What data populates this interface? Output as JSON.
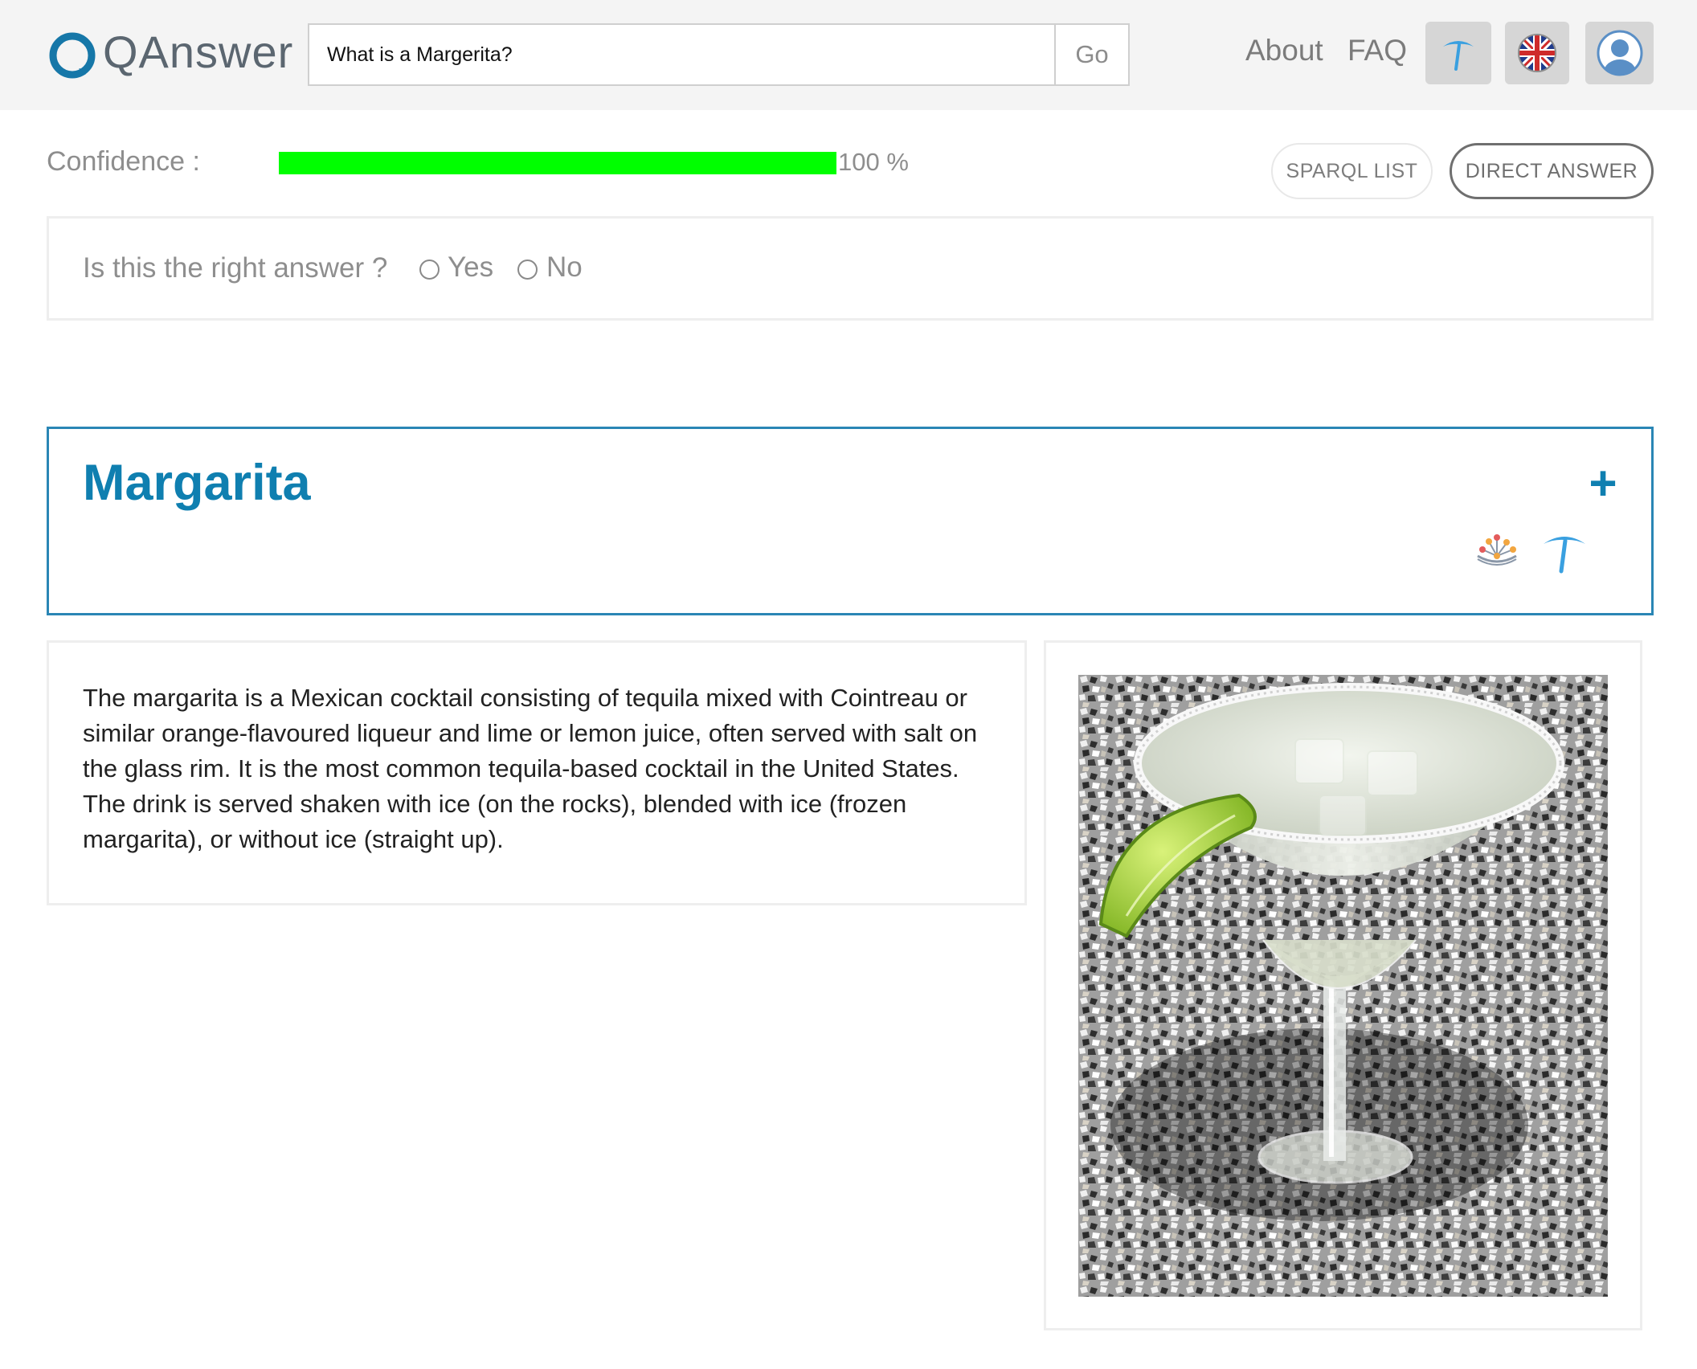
{
  "header": {
    "logo_text": "QAnswer",
    "search_value": "What is a Margerita?",
    "go_label": "Go",
    "nav": {
      "about": "About",
      "faq": "FAQ"
    },
    "icons": [
      "umbrella-icon",
      "uk-flag-icon",
      "user-icon"
    ]
  },
  "confidence": {
    "label": "Confidence :",
    "value_text": "100 %",
    "percent": 100,
    "bar_color": "#00ff00"
  },
  "modes": {
    "sparql_list": "SPARQL LIST",
    "direct_answer": "DIRECT ANSWER"
  },
  "feedback": {
    "question": "Is this the right answer ?",
    "yes": "Yes",
    "no": "No"
  },
  "answer": {
    "title": "Margarita",
    "plus": "+",
    "source_icons": [
      "knowledge-graph-icon",
      "umbrella-icon"
    ],
    "description": "The margarita is a Mexican cocktail consisting of tequila mixed with Cointreau or similar orange-flavoured liqueur and lime or lemon juice, often served with salt on the glass rim. It is the most common tequila-based cocktail in the United States. The drink is served shaken with ice (on the rocks), blended with ice (frozen margarita), or without ice (straight up)."
  },
  "colors": {
    "accent": "#0f7fb0",
    "border": "#2a86b5",
    "umbrella": "#3aa0e0"
  }
}
